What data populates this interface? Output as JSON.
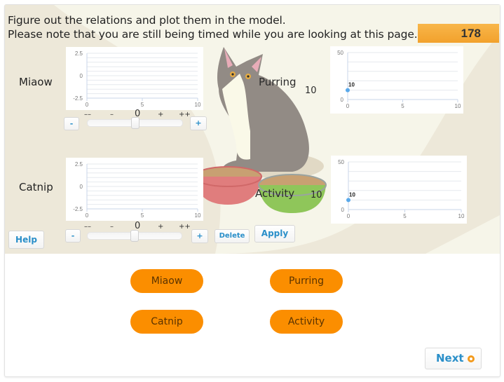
{
  "instructions": {
    "line1": "Figure out the relations and plot them in the model.",
    "line2": "Please note that you are still being timed while you are looking at this page."
  },
  "timer": {
    "value": "178",
    "color": "#f5a83a"
  },
  "inputs": [
    {
      "label": "Miaow",
      "chart": {
        "ylim": [
          -2.5,
          2.5
        ],
        "yticks": [
          "2.5",
          "0",
          "-2.5"
        ],
        "xticks": [
          "0",
          "5",
          "10"
        ]
      },
      "slider": {
        "scale": [
          "––",
          "–",
          "0",
          "+",
          "++"
        ],
        "value": 0,
        "minus_label": "-",
        "plus_label": "+"
      }
    },
    {
      "label": "Catnip",
      "chart": {
        "ylim": [
          -2.5,
          2.5
        ],
        "yticks": [
          "2.5",
          "0",
          "-2.5"
        ],
        "xticks": [
          "0",
          "5",
          "10"
        ]
      },
      "slider": {
        "scale": [
          "––",
          "–",
          "0",
          "+",
          "++"
        ],
        "value": 0,
        "minus_label": "-",
        "plus_label": "+"
      }
    }
  ],
  "outputs": [
    {
      "label": "Purring",
      "value": "10",
      "chart": {
        "ylim": [
          0,
          50
        ],
        "yticks": [
          "50",
          "0"
        ],
        "xticks": [
          "0",
          "5",
          "10"
        ],
        "points": [
          {
            "x": 0,
            "y": 10,
            "label": "10"
          }
        ]
      }
    },
    {
      "label": "Activity",
      "value": "10",
      "chart": {
        "ylim": [
          0,
          50
        ],
        "yticks": [
          "50",
          "0"
        ],
        "xticks": [
          "0",
          "5",
          "10"
        ],
        "points": [
          {
            "x": 0,
            "y": 10,
            "label": "10"
          }
        ]
      }
    }
  ],
  "buttons": {
    "help": "Help",
    "delete": "Delete",
    "apply": "Apply",
    "next": "Next"
  },
  "variables": [
    "Miaow",
    "Purring",
    "Catnip",
    "Activity"
  ],
  "colors": {
    "accent": "#2a8fc9",
    "pill": "#fb8e00",
    "point": "#5aa9ea"
  }
}
